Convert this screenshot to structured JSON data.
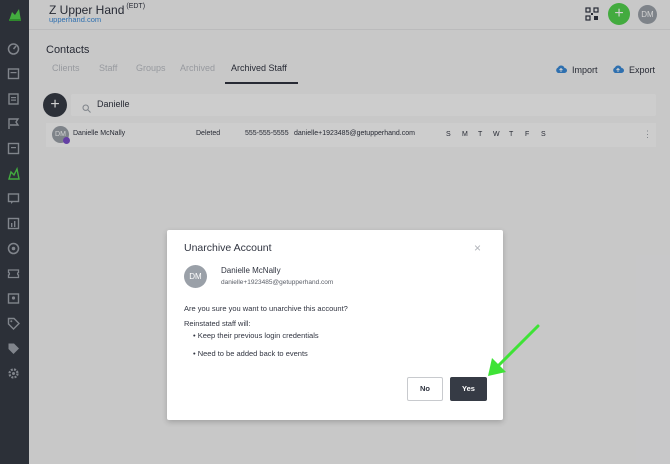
{
  "header": {
    "app_title": "Z Upper Hand",
    "timezone": "(EDT)",
    "url": "upperhand.com",
    "add_label": "+",
    "user_initials": "DM"
  },
  "page": {
    "title": "Contacts",
    "tabs": [
      {
        "label": "Clients"
      },
      {
        "label": "Staff"
      },
      {
        "label": "Groups"
      },
      {
        "label": "Archived"
      },
      {
        "label": "Archived Staff"
      }
    ],
    "import_label": "Import",
    "export_label": "Export",
    "fab_label": "+"
  },
  "search": {
    "value": "Danielle"
  },
  "row": {
    "initials": "DM",
    "name": "Danielle McNally",
    "status": "Deleted",
    "phone": "555-555-5555",
    "email": "danielle+1923485@getupperhand.com",
    "days": [
      "S",
      "M",
      "T",
      "W",
      "T",
      "F",
      "S"
    ],
    "menu": "⋮"
  },
  "modal": {
    "title": "Unarchive Account",
    "close": "×",
    "initials": "DM",
    "name": "Danielle McNally",
    "email": "danielle+1923485@getupperhand.com",
    "question": "Are you sure you want to unarchive this account?",
    "subtitle": "Reinstated staff will:",
    "bullets": [
      "• Keep their previous login credentials",
      "• Need to be added back to events"
    ],
    "no_label": "No",
    "yes_label": "Yes"
  },
  "colors": {
    "sidebar": "#363b45",
    "brand_green": "#52d14d",
    "link_blue": "#3a89d6",
    "badge_purple": "#7b4ec8",
    "annotation_arrow": "#3ee336"
  },
  "icons": [
    "logo-icon",
    "dashboard-icon",
    "calendar-icon",
    "clipboard-icon",
    "flag-icon",
    "contacts-icon",
    "chat-icon",
    "report-icon",
    "cloud-icon",
    "ticket-icon",
    "card-icon",
    "tag-icon",
    "gear-icon",
    "qr-icon",
    "search-icon",
    "import-icon",
    "export-icon"
  ]
}
